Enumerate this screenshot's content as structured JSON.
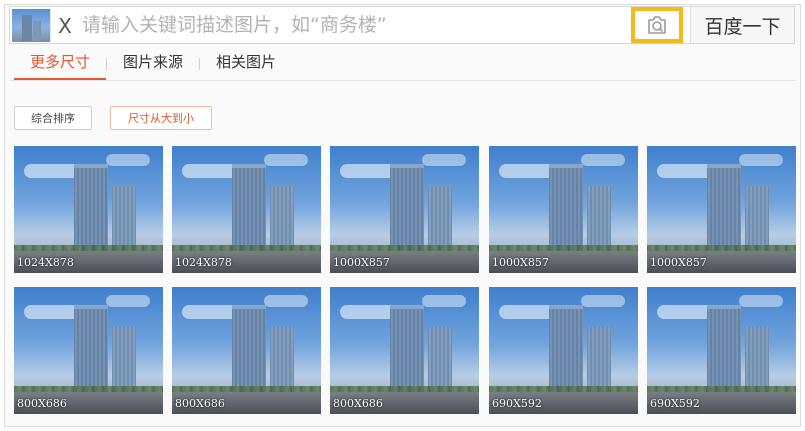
{
  "search": {
    "clear_label": "X",
    "placeholder": "请输入关键词描述图片，如“商务楼”",
    "submit_label": "百度一下"
  },
  "tabs": [
    {
      "label": "更多尺寸",
      "active": true
    },
    {
      "label": "图片来源",
      "active": false
    },
    {
      "label": "相关图片",
      "active": false
    }
  ],
  "sort": {
    "default_label": "综合排序",
    "size_label": "尺寸从大到小"
  },
  "results": [
    {
      "size": "1024X878"
    },
    {
      "size": "1024X878"
    },
    {
      "size": "1000X857"
    },
    {
      "size": "1000X857"
    },
    {
      "size": "1000X857"
    },
    {
      "size": "800X686"
    },
    {
      "size": "800X686"
    },
    {
      "size": "800X686"
    },
    {
      "size": "690X592"
    },
    {
      "size": "690X592"
    }
  ],
  "colors": {
    "accent": "#e4572e",
    "camera_highlight": "#f5b91c"
  },
  "icons": {
    "camera": "camera-search-icon"
  }
}
